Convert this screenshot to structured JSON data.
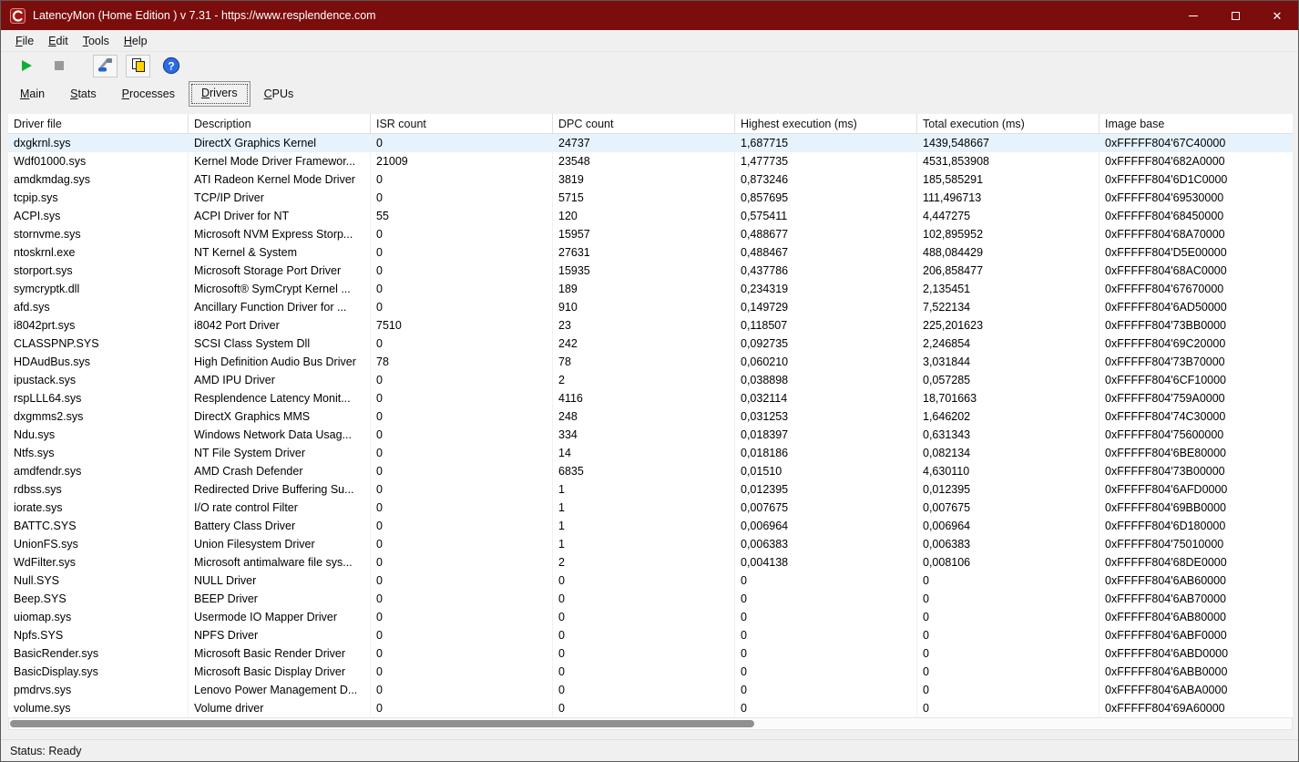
{
  "window": {
    "title": "LatencyMon  (Home Edition )  v 7.31 - https://www.resplendence.com",
    "status": "Status: Ready"
  },
  "menu": {
    "items": [
      {
        "label": "File",
        "underline": 0
      },
      {
        "label": "Edit",
        "underline": 0
      },
      {
        "label": "Tools",
        "underline": 0
      },
      {
        "label": "Help",
        "underline": 0
      }
    ]
  },
  "toolbar": {
    "buttons": [
      {
        "name": "start-monitor",
        "icon": "play-icon",
        "enabled": true
      },
      {
        "name": "stop-monitor",
        "icon": "stop-icon",
        "enabled": false
      },
      {
        "name": "options",
        "icon": "tools-icon",
        "enabled": true
      },
      {
        "name": "copy-report",
        "icon": "copy-icon",
        "enabled": true
      },
      {
        "name": "help",
        "icon": "help-icon",
        "enabled": true
      }
    ]
  },
  "tabs": [
    {
      "label": "Main",
      "underline": 0,
      "active": false
    },
    {
      "label": "Stats",
      "underline": 0,
      "active": false
    },
    {
      "label": "Processes",
      "underline": 0,
      "active": false
    },
    {
      "label": "Drivers",
      "underline": 0,
      "active": true
    },
    {
      "label": "CPUs",
      "underline": 0,
      "active": false
    }
  ],
  "table": {
    "columns": [
      "Driver file",
      "Description",
      "ISR count",
      "DPC count",
      "Highest execution (ms)",
      "Total execution (ms)",
      "Image base"
    ],
    "selected_row": 0,
    "rows": [
      [
        "dxgkrnl.sys",
        "DirectX Graphics Kernel",
        "0",
        "24737",
        "1,687715",
        "1439,548667",
        "0xFFFFF804'67C40000"
      ],
      [
        "Wdf01000.sys",
        "Kernel Mode Driver Framewor...",
        "21009",
        "23548",
        "1,477735",
        "4531,853908",
        "0xFFFFF804'682A0000"
      ],
      [
        "amdkmdag.sys",
        "ATI Radeon Kernel Mode Driver",
        "0",
        "3819",
        "0,873246",
        "185,585291",
        "0xFFFFF804'6D1C0000"
      ],
      [
        "tcpip.sys",
        "TCP/IP Driver",
        "0",
        "5715",
        "0,857695",
        "111,496713",
        "0xFFFFF804'69530000"
      ],
      [
        "ACPI.sys",
        "ACPI Driver for NT",
        "55",
        "120",
        "0,575411",
        "4,447275",
        "0xFFFFF804'68450000"
      ],
      [
        "stornvme.sys",
        "Microsoft NVM Express Storp...",
        "0",
        "15957",
        "0,488677",
        "102,895952",
        "0xFFFFF804'68A70000"
      ],
      [
        "ntoskrnl.exe",
        "NT Kernel & System",
        "0",
        "27631",
        "0,488467",
        "488,084429",
        "0xFFFFF804'D5E00000"
      ],
      [
        "storport.sys",
        "Microsoft Storage Port Driver",
        "0",
        "15935",
        "0,437786",
        "206,858477",
        "0xFFFFF804'68AC0000"
      ],
      [
        "symcryptk.dll",
        "Microsoft® SymCrypt Kernel ...",
        "0",
        "189",
        "0,234319",
        "2,135451",
        "0xFFFFF804'67670000"
      ],
      [
        "afd.sys",
        "Ancillary Function Driver for ...",
        "0",
        "910",
        "0,149729",
        "7,522134",
        "0xFFFFF804'6AD50000"
      ],
      [
        "i8042prt.sys",
        "i8042 Port Driver",
        "7510",
        "23",
        "0,118507",
        "225,201623",
        "0xFFFFF804'73BB0000"
      ],
      [
        "CLASSPNP.SYS",
        "SCSI Class System Dll",
        "0",
        "242",
        "0,092735",
        "2,246854",
        "0xFFFFF804'69C20000"
      ],
      [
        "HDAudBus.sys",
        "High Definition Audio Bus Driver",
        "78",
        "78",
        "0,060210",
        "3,031844",
        "0xFFFFF804'73B70000"
      ],
      [
        "ipustack.sys",
        "AMD IPU Driver",
        "0",
        "2",
        "0,038898",
        "0,057285",
        "0xFFFFF804'6CF10000"
      ],
      [
        "rspLLL64.sys",
        "Resplendence Latency Monit...",
        "0",
        "4116",
        "0,032114",
        "18,701663",
        "0xFFFFF804'759A0000"
      ],
      [
        "dxgmms2.sys",
        "DirectX Graphics MMS",
        "0",
        "248",
        "0,031253",
        "1,646202",
        "0xFFFFF804'74C30000"
      ],
      [
        "Ndu.sys",
        "Windows Network Data Usag...",
        "0",
        "334",
        "0,018397",
        "0,631343",
        "0xFFFFF804'75600000"
      ],
      [
        "Ntfs.sys",
        "NT File System Driver",
        "0",
        "14",
        "0,018186",
        "0,082134",
        "0xFFFFF804'6BE80000"
      ],
      [
        "amdfendr.sys",
        "AMD Crash Defender",
        "0",
        "6835",
        "0,01510",
        "4,630110",
        "0xFFFFF804'73B00000"
      ],
      [
        "rdbss.sys",
        "Redirected Drive Buffering Su...",
        "0",
        "1",
        "0,012395",
        "0,012395",
        "0xFFFFF804'6AFD0000"
      ],
      [
        "iorate.sys",
        "I/O rate control Filter",
        "0",
        "1",
        "0,007675",
        "0,007675",
        "0xFFFFF804'69BB0000"
      ],
      [
        "BATTC.SYS",
        "Battery Class Driver",
        "0",
        "1",
        "0,006964",
        "0,006964",
        "0xFFFFF804'6D180000"
      ],
      [
        "UnionFS.sys",
        "Union Filesystem Driver",
        "0",
        "1",
        "0,006383",
        "0,006383",
        "0xFFFFF804'75010000"
      ],
      [
        "WdFilter.sys",
        "Microsoft antimalware file sys...",
        "0",
        "2",
        "0,004138",
        "0,008106",
        "0xFFFFF804'68DE0000"
      ],
      [
        "Null.SYS",
        "NULL Driver",
        "0",
        "0",
        "0",
        "0",
        "0xFFFFF804'6AB60000"
      ],
      [
        "Beep.SYS",
        "BEEP Driver",
        "0",
        "0",
        "0",
        "0",
        "0xFFFFF804'6AB70000"
      ],
      [
        "uiomap.sys",
        "Usermode IO Mapper Driver",
        "0",
        "0",
        "0",
        "0",
        "0xFFFFF804'6AB80000"
      ],
      [
        "Npfs.SYS",
        "NPFS Driver",
        "0",
        "0",
        "0",
        "0",
        "0xFFFFF804'6ABF0000"
      ],
      [
        "BasicRender.sys",
        "Microsoft Basic Render Driver",
        "0",
        "0",
        "0",
        "0",
        "0xFFFFF804'6ABD0000"
      ],
      [
        "BasicDisplay.sys",
        "Microsoft Basic Display Driver",
        "0",
        "0",
        "0",
        "0",
        "0xFFFFF804'6ABB0000"
      ],
      [
        "pmdrvs.sys",
        "Lenovo Power Management D...",
        "0",
        "0",
        "0",
        "0",
        "0xFFFFF804'6ABA0000"
      ],
      [
        "volume.sys",
        "Volume driver",
        "0",
        "0",
        "0",
        "0",
        "0xFFFFF804'69A60000"
      ]
    ]
  },
  "colors": {
    "titlebar": "#7c0d0d",
    "selected_row": "#e6f3fc",
    "play_green": "#0faf36",
    "help_blue": "#2d6be3",
    "copy_yellow": "#ffd400"
  }
}
